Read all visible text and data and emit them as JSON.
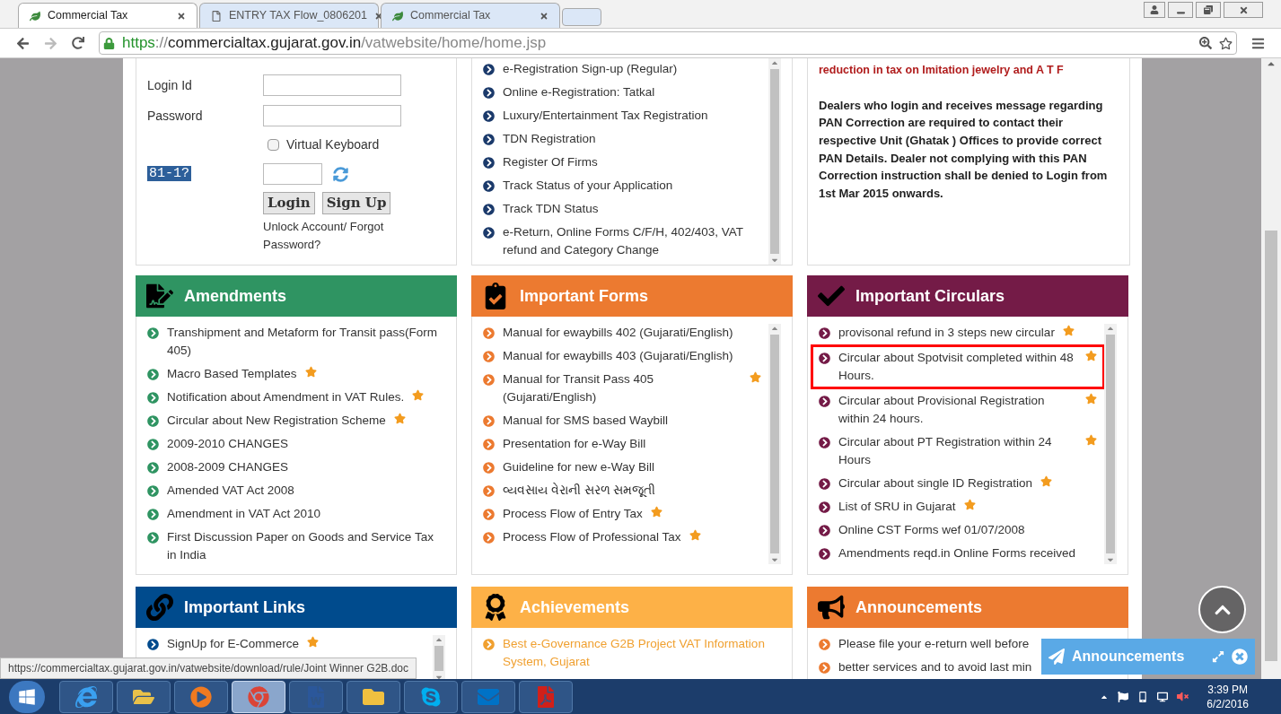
{
  "browser": {
    "tabs": [
      {
        "title": "Commercial Tax",
        "kind": "site",
        "selected": true
      },
      {
        "title": "ENTRY TAX Flow_0806201",
        "kind": "document",
        "selected": false
      },
      {
        "title": "Commercial Tax",
        "kind": "site",
        "selected": false
      }
    ],
    "address": {
      "scheme": "https",
      "separator": "://",
      "host": "commercialtax.gujarat.gov.in",
      "path": "/vatwebsite/home/home.jsp"
    }
  },
  "login": {
    "fields": [
      {
        "label": "Login Id"
      },
      {
        "label": "Password"
      }
    ],
    "virtual_keyboard": {
      "label": "Virtual Keyboard",
      "checked": false
    },
    "captcha": "81-1?",
    "buttons": [
      "Login",
      "Sign Up"
    ],
    "link": "Unlock Account/ Forgot Password?"
  },
  "registration_links": [
    "e-Registration Sign-up (Regular)",
    "Online e-Registration: Tatkal",
    "Luxury/Entertainment Tax Registration",
    "TDN Registration",
    "Register Of Firms",
    "Track Status of your Application",
    "Track TDN Status",
    "e-Return, Online Forms C/F/H, 402/403, VAT refund and Category Change"
  ],
  "notice": {
    "headline": "reduction in tax on Imitation jewelry and A T F",
    "body": "Dealers who login and receives message regarding PAN Correction are required to contact their respective Unit (Ghatak ) Offices to provide correct PAN Details. Dealer not complying with this PAN Correction instruction shall be denied to Login from 1st Mar 2015 onwards."
  },
  "sections": [
    {
      "title": "Amendments",
      "color": "#2f9462",
      "kind": "plain",
      "scrollable": false,
      "items": [
        {
          "text": "Transhipment and Metaform for Transit pass(Form 405)",
          "star": false,
          "highlighted": false
        },
        {
          "text": "Macro Based Templates",
          "star": true,
          "highlighted": false
        },
        {
          "text": "Notification about Amendment in VAT Rules.",
          "star": true,
          "highlighted": false
        },
        {
          "text": "Circular about New Registration Scheme",
          "star": true,
          "highlighted": false
        },
        {
          "text": "2009-2010 CHANGES",
          "star": false,
          "highlighted": false
        },
        {
          "text": "2008-2009 CHANGES",
          "star": false,
          "highlighted": false
        },
        {
          "text": "Amended VAT Act 2008",
          "star": false,
          "highlighted": false
        },
        {
          "text": "Amendment in VAT Act 2010",
          "star": false,
          "highlighted": false
        },
        {
          "text": "First Discussion Paper on Goods and Service Tax in India",
          "star": false,
          "highlighted": false
        }
      ]
    },
    {
      "title": "Important Forms",
      "color": "#ec7a30",
      "kind": "plain",
      "scrollable": true,
      "items": [
        {
          "text": "Manual for ewaybills 402 (Gujarati/English)",
          "star": false,
          "highlighted": false
        },
        {
          "text": "Manual for ewaybills 403 (Gujarati/English)",
          "star": false,
          "highlighted": false
        },
        {
          "text": "Manual for Transit Pass 405 (Gujarati/English)",
          "star": true,
          "highlighted": false
        },
        {
          "text": "Manual for SMS based Waybill",
          "star": false,
          "highlighted": false
        },
        {
          "text": "Presentation for e-Way Bill",
          "star": false,
          "highlighted": false
        },
        {
          "text": "Guideline for new e-Way Bill",
          "star": false,
          "highlighted": false
        },
        {
          "text": "વ્યવસાય વેરાની સરળ સમજૂતી",
          "star": false,
          "highlighted": false
        },
        {
          "text": "Process Flow of Entry Tax",
          "star": true,
          "highlighted": false
        },
        {
          "text": "Process Flow of Professional Tax",
          "star": true,
          "highlighted": false
        }
      ]
    },
    {
      "title": "Important Circulars",
      "color": "#741b47",
      "kind": "plain",
      "scrollable": true,
      "items": [
        {
          "text": "provisonal refund in 3 steps new circular",
          "star": true,
          "highlighted": false
        },
        {
          "text": "Circular about Spotvisit completed within 48 Hours.",
          "star": true,
          "highlighted": true
        },
        {
          "text": "Circular about Provisional Registration within 24 hours.",
          "star": true,
          "highlighted": false
        },
        {
          "text": "Circular about PT Registration within 24 Hours",
          "star": true,
          "highlighted": false
        },
        {
          "text": "Circular about single ID Registration",
          "star": true,
          "highlighted": false
        },
        {
          "text": "List of SRU in Gujarat",
          "star": true,
          "highlighted": false
        },
        {
          "text": "Online CST Forms wef 01/07/2008",
          "star": false,
          "highlighted": false
        },
        {
          "text": "Amendments reqd.in Online Forms received",
          "star": false,
          "highlighted": false
        }
      ]
    },
    {
      "title": "Important Links",
      "color": "#004b8d",
      "kind": "plain",
      "scrollable": true,
      "items": [
        {
          "text": "SignUp for E-Commerce",
          "star": true,
          "highlighted": false
        }
      ]
    },
    {
      "title": "Achievements",
      "color": "#fdb147",
      "kind": "accent",
      "scrollable": false,
      "items": [
        {
          "text": "Best e-Governance G2B Project VAT Information System, Gujarat",
          "star": false,
          "highlighted": false
        }
      ]
    },
    {
      "title": "Announcements",
      "color": "#ec7a30",
      "kind": "plain",
      "scrollable": false,
      "items": [
        {
          "text": "Please file your e-return well before",
          "star": false,
          "highlighted": false
        },
        {
          "text": "better services and to avoid last min",
          "star": false,
          "highlighted": false
        }
      ]
    }
  ],
  "status_url": "https://commercialtax.gujarat.gov.in/vatwebsite/download/rule/Joint Winner G2B.doc",
  "popup": {
    "title": "Announcements"
  },
  "taskbar": {
    "apps": [
      {
        "kind": "browser-e",
        "selected": false
      },
      {
        "kind": "explorer",
        "selected": false
      },
      {
        "kind": "media",
        "selected": false
      },
      {
        "kind": "browser-round",
        "selected": true
      },
      {
        "kind": "word",
        "selected": false
      },
      {
        "kind": "folders",
        "selected": false
      },
      {
        "kind": "messenger",
        "selected": false
      },
      {
        "kind": "mail",
        "selected": false
      },
      {
        "kind": "pdf",
        "selected": false
      }
    ],
    "time": "3:39 PM",
    "date": "6/2/2016"
  }
}
